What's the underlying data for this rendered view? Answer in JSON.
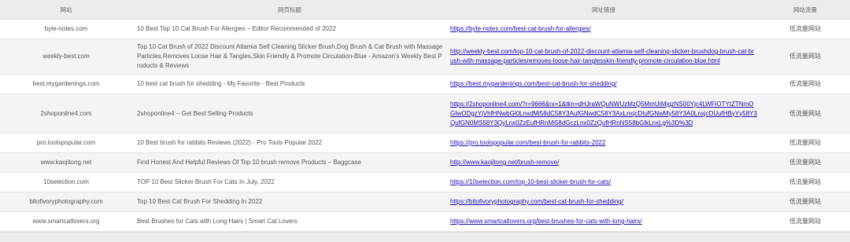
{
  "headers": {
    "site": "网站",
    "title": "网页标题",
    "url": "网址链接",
    "traffic": "网站流量"
  },
  "rows": [
    {
      "site": "byte-notes.com",
      "title": "10 Best Top 10 Cat Brush For Allergies – Editor Recommended of 2022",
      "url": "https://byte-notes.com/best-cat-brush-for-allergies/",
      "traffic": "低流量网站"
    },
    {
      "site": "weekly-best.com",
      "title": "Top 10 Cat Brush of 2022 Discount Atlamia Self Cleaning Slicker Brush,Dog Brush & Cat Brush with Massage Particles,Removes Loose Hair & Tangles,Skin Friendly & Promote Circulation-Blue - Amazon's Weekly Best Products & Reviews",
      "url": "http://weekly-best.com/top-10-cat-brush-of-2022-discount-atlamia-self-cleaning-slicker-brushdog-brush-cat-brush-with-massage-particlesremoves-loose-hair-tanglesskin-friendly-promote-circulation-blue.html",
      "traffic": "低流量网站"
    },
    {
      "site": "best.mygardenings.com",
      "title": "10 best cat brush for shedding - My Favorite - Best Products",
      "url": "https://best.mygardenings.com/best-cat-brush-for-shedding/",
      "traffic": "低流量网站"
    },
    {
      "site": "2shoponline4.com",
      "title": "2shoponline4 – Get Best Selling Products",
      "url": "https://2shoponline4.com/?r=9666&rx=1&tkn=dHJraWQuNWUzMzQ5MmUtMjgzNS00Yjc4LWFiOTYtZTNmOGIwODgzYjVhfHNwbGl0LnxdMi58dC58Y3AufGNwdC58Y3AxLnxjcDIufGNwMy58Y3A0LnxjcDUufHByYy58Y3QufGN0MS58Y3QyLnx0ZzEufHRnMi58dGczLnx0ZzQufHRnNS58bGlkLnxLg%3D%3D",
      "traffic": "低流量网站"
    },
    {
      "site": "pro.toolspopular.com",
      "title": "10 Best brush for rabbits Reviews (2022) - Pro Tools Popular 2022",
      "url": "https://pro.toolspopular.com/best-brush-for-rabbits-2022",
      "traffic": "低流量网站"
    },
    {
      "site": "www.kaojitong.net",
      "title": "Find Honest And Helpful Reviews Of Top 10 brush remove Products – Baggcase",
      "url": "http://www.kaojitong.net/brush-remove/",
      "traffic": "低流量网站"
    },
    {
      "site": "10selection.com",
      "title": "TOP 10 Best Slicker Brush For Cats In July, 2022",
      "url": "https://10selection.com/top-10-best-slicker-brush-for-cats/",
      "traffic": "低流量网站"
    },
    {
      "site": "bitofivoryphotography.com",
      "title": "Top 10 Best Cat Brush For Shedding In 2022",
      "url": "https://bitofivoryphotography.com/best-cat-brush-for-shedding/",
      "traffic": "低流量网站"
    },
    {
      "site": "www.smartcatlovers.org",
      "title": "Best Brushes for Cats with Long Hairs | Smart Cat Lovers",
      "url": "https://www.smartcatlovers.org/best-brushes-for-cats-with-long-hairs/",
      "traffic": "低流量网站"
    }
  ]
}
